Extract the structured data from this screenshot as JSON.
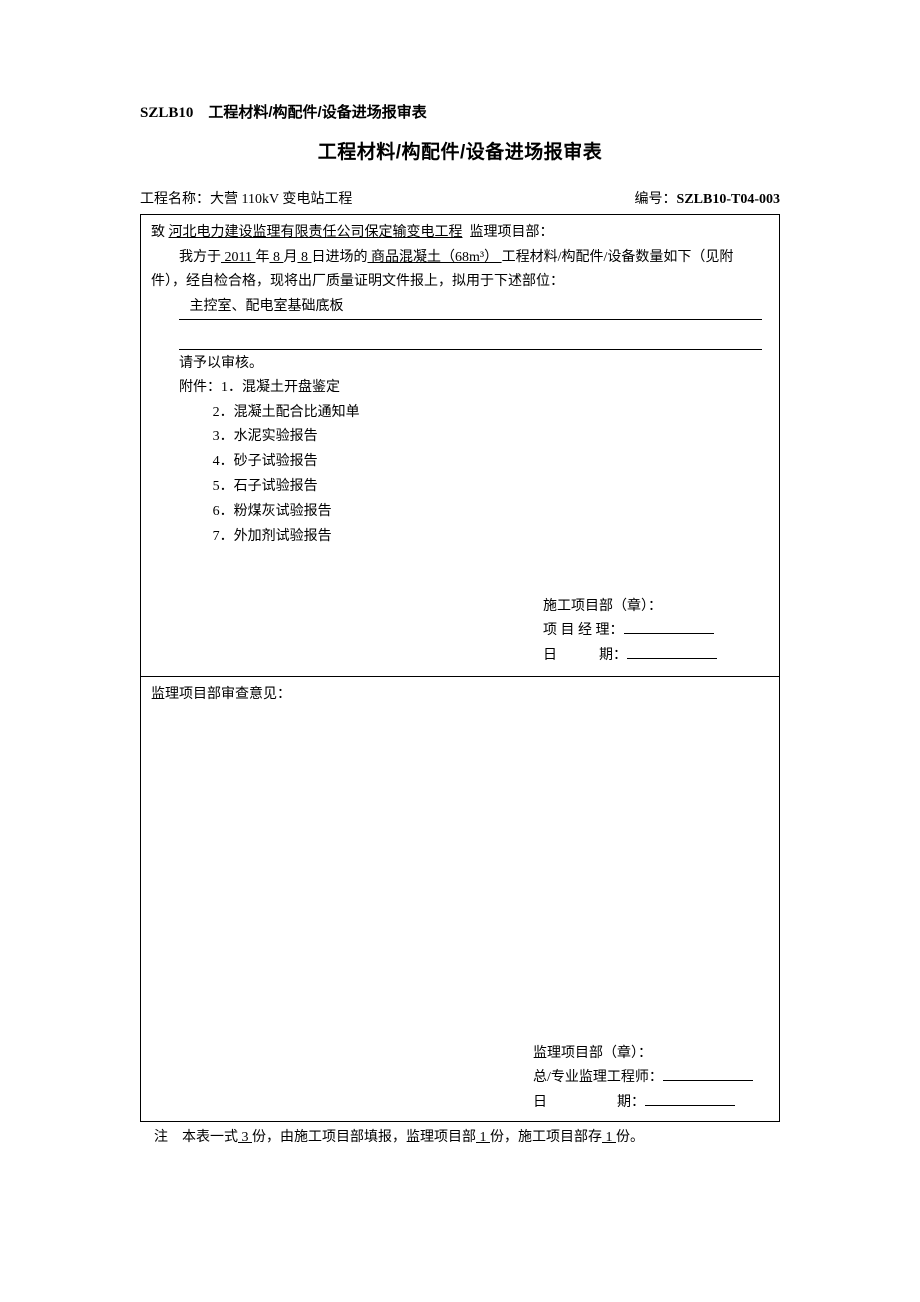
{
  "header": {
    "code_prefix": "SZLB10",
    "code_title": "工程材料/构配件/设备进场报审表"
  },
  "title": "工程材料/构配件/设备进场报审表",
  "meta": {
    "project_label": "工程名称：",
    "project_name": "大营 110kV 变电站工程",
    "serial_label": "编号：",
    "serial_value": "SZLB10-T04-003"
  },
  "cell1": {
    "to_prefix": "致",
    "to_company": "河北电力建设监理有限责任公司保定输变电工程",
    "to_suffix": "监理项目部：",
    "line2_a": "我方于",
    "year": " 2011 ",
    "year_suffix": "年",
    "month": " 8 ",
    "month_suffix": "月",
    "day": " 8 ",
    "day_suffix": "日进场的",
    "material": " 商品混凝土（68m³） ",
    "material_suffix": "工程材料/构配件/设备数量如下（见附",
    "line3": "件），经自检合格，现将出厂质量证明文件报上，拟用于下述部位：",
    "usage": "主控室、配电室基础底板",
    "line5": "请予以审核。",
    "attach_intro": "附件：1．混凝土开盘鉴定",
    "attachments": {
      "a2": "2．混凝土配合比通知单",
      "a3": "3．水泥实验报告",
      "a4": "4．砂子试验报告",
      "a5": "5．石子试验报告",
      "a6": "6．粉煤灰试验报告",
      "a7": "7．外加剂试验报告"
    },
    "sig": {
      "dept": "施工项目部（章）：",
      "pm_label": "项 目 经 理：",
      "date_label": "日　　　期："
    }
  },
  "cell2": {
    "heading": "监理项目部审查意见：",
    "sig": {
      "dept": "监理项目部（章）：",
      "eng_label": "总/专业监理工程师：",
      "date_label": "日　　　　　期："
    }
  },
  "footnote": {
    "prefix": "注　本表一式",
    "copies_total": " 3 ",
    "mid1": "份，由施工项目部填报，监理项目部",
    "copies_a": " 1 ",
    "mid2": "份，施工项目部存",
    "copies_b": " 1 ",
    "suffix": "份。"
  }
}
